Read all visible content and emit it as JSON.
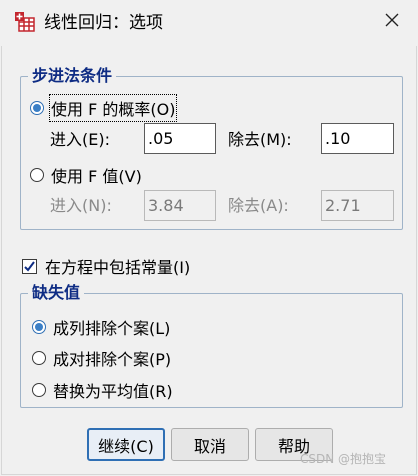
{
  "window": {
    "title": "线性回归：选项",
    "close_icon": "close-icon",
    "app_icon": "spss-table-icon"
  },
  "stepping": {
    "legend": "步进法条件",
    "use_prob_label": "使用 F 的概率(O)",
    "use_prob_selected": true,
    "entry_prob_label": "进入(E):",
    "entry_prob_value": ".05",
    "removal_prob_label": "除去(M):",
    "removal_prob_value": ".10",
    "use_value_label": "使用 F 值(V)",
    "use_value_selected": false,
    "entry_value_label": "进入(N):",
    "entry_value_value": "3.84",
    "removal_value_label": "除去(A):",
    "removal_value_value": "2.71"
  },
  "include_constant": {
    "label": "在方程中包括常量(I)",
    "checked": true
  },
  "missing": {
    "legend": "缺失值",
    "options": [
      {
        "label": "成列排除个案(L)",
        "selected": true
      },
      {
        "label": "成对排除个案(P)",
        "selected": false
      },
      {
        "label": "替换为平均值(R)",
        "selected": false
      }
    ]
  },
  "buttons": {
    "continue_label": "继续(C)",
    "cancel_label": "取消",
    "help_label": "帮助"
  },
  "watermark": "CSDN @抱抱宝",
  "colors": {
    "accent": "#2f6fb4",
    "legend_text": "#0e2c84",
    "group_border": "#9fb3c8",
    "background": "#f0f0f0"
  }
}
